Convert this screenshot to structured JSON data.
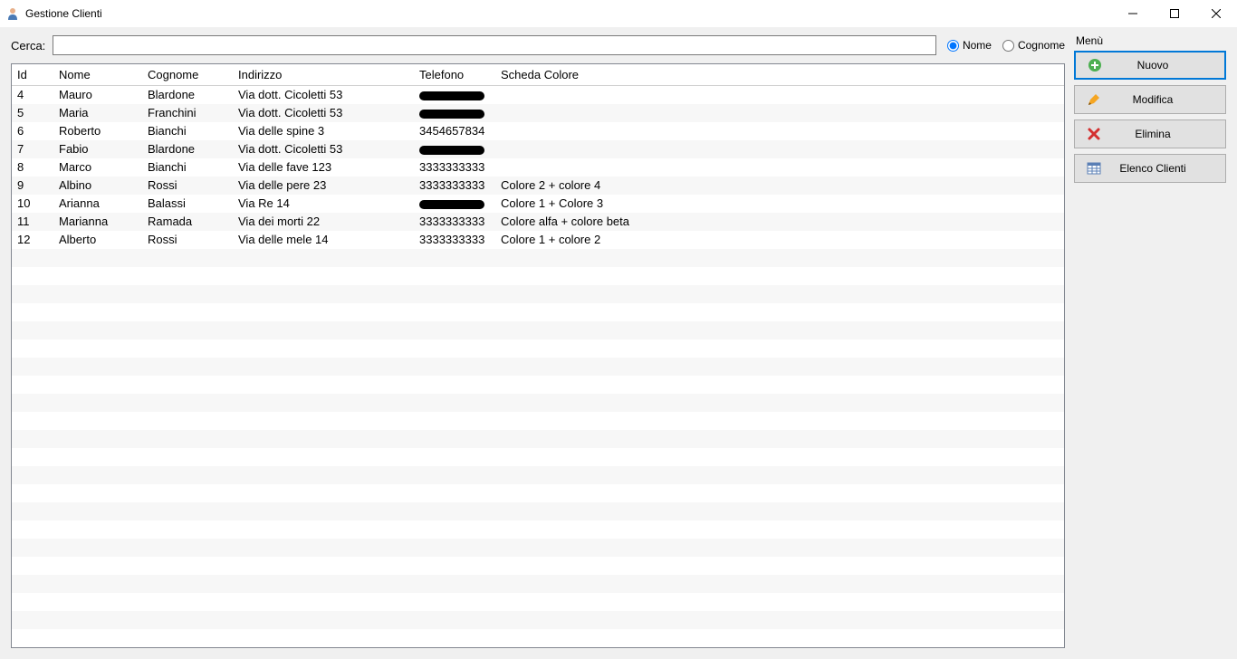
{
  "window": {
    "title": "Gestione Clienti"
  },
  "search": {
    "label": "Cerca:",
    "value": "",
    "radio_nome": "Nome",
    "radio_cognome": "Cognome",
    "selected": "nome"
  },
  "columns": {
    "id": "Id",
    "nome": "Nome",
    "cognome": "Cognome",
    "indirizzo": "Indirizzo",
    "telefono": "Telefono",
    "scheda": "Scheda Colore"
  },
  "rows": [
    {
      "id": "4",
      "nome": "Mauro",
      "cognome": "Blardone",
      "indirizzo": "Via dott. Cicoletti 53",
      "telefono_redacted": true,
      "scheda": ""
    },
    {
      "id": "5",
      "nome": "Maria",
      "cognome": "Franchini",
      "indirizzo": "Via dott. Cicoletti 53",
      "telefono_redacted": true,
      "scheda": ""
    },
    {
      "id": "6",
      "nome": "Roberto",
      "cognome": "Bianchi",
      "indirizzo": "Via delle spine 3",
      "telefono": "3454657834",
      "scheda": ""
    },
    {
      "id": "7",
      "nome": "Fabio",
      "cognome": "Blardone",
      "indirizzo": "Via dott. Cicoletti 53",
      "telefono_redacted": true,
      "scheda": ""
    },
    {
      "id": "8",
      "nome": "Marco",
      "cognome": "Bianchi",
      "indirizzo": "Via delle fave 123",
      "telefono": "3333333333",
      "scheda": ""
    },
    {
      "id": "9",
      "nome": "Albino",
      "cognome": "Rossi",
      "indirizzo": "Via delle pere 23",
      "telefono": "3333333333",
      "scheda": "Colore 2 + colore 4"
    },
    {
      "id": "10",
      "nome": "Arianna",
      "cognome": "Balassi",
      "indirizzo": "Via Re 14",
      "telefono_redacted": true,
      "scheda": "Colore 1 + Colore 3"
    },
    {
      "id": "11",
      "nome": "Marianna",
      "cognome": "Ramada",
      "indirizzo": "Via dei morti 22",
      "telefono": "3333333333",
      "scheda": "Colore alfa + colore beta"
    },
    {
      "id": "12",
      "nome": "Alberto",
      "cognome": "Rossi",
      "indirizzo": "Via delle mele 14",
      "telefono": "3333333333",
      "scheda": "Colore 1 + colore 2"
    }
  ],
  "menu": {
    "title": "Menù",
    "nuovo": "Nuovo",
    "modifica": "Modifica",
    "elimina": "Elimina",
    "elenco": "Elenco Clienti"
  },
  "empty_rows": 22
}
